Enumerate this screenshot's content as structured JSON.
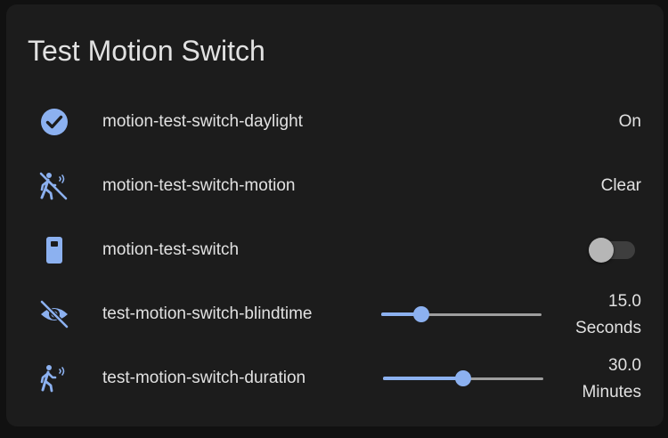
{
  "card": {
    "title": "Test Motion Switch"
  },
  "colors": {
    "accent": "#8cb1f0",
    "card_bg": "#1c1c1c",
    "page_bg": "#111111",
    "text": "#e1e1e1"
  },
  "entities": [
    {
      "icon": "checkbox-marked-circle-icon",
      "name": "motion-test-switch-daylight",
      "state": "On"
    },
    {
      "icon": "motion-sensor-off-icon",
      "name": "motion-test-switch-motion",
      "state": "Clear"
    },
    {
      "icon": "switch-icon",
      "name": "motion-test-switch",
      "toggle_on": false
    },
    {
      "icon": "eye-off-icon",
      "name": "test-motion-switch-blindtime",
      "value": "15.0",
      "unit": "Seconds",
      "slider_fraction": 0.25
    },
    {
      "icon": "motion-sensor-icon",
      "name": "test-motion-switch-duration",
      "value": "30.0",
      "unit": "Minutes",
      "slider_fraction": 0.5
    }
  ]
}
